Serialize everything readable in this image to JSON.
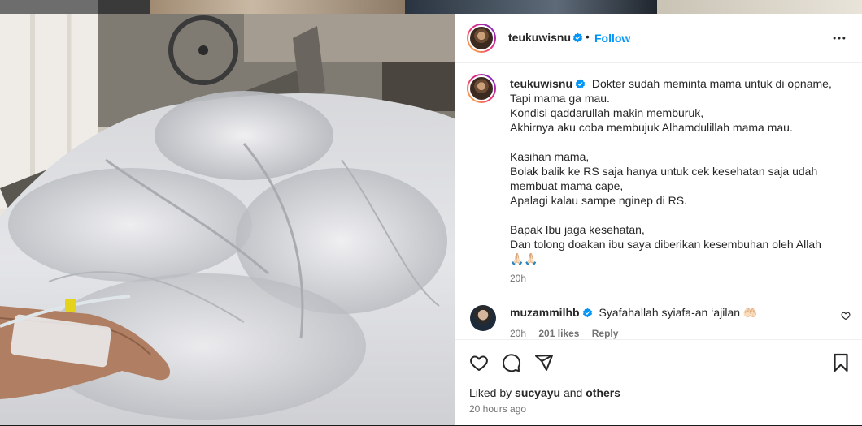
{
  "post": {
    "author": "teukuwisnu",
    "follow_label": "Follow",
    "header_separator": "•",
    "caption_lines": [
      "Dokter sudah meminta mama untuk di opname,",
      "Tapi mama ga mau.",
      "Kondisi qaddarullah makin memburuk,",
      "Akhirnya aku coba membujuk Alhamdulillah mama mau.",
      "",
      "Kasihan mama,",
      "Bolak balik ke RS saja hanya untuk cek kesehatan saja udah",
      "membuat mama cape,",
      "Apalagi kalau sampe nginep di RS.",
      "",
      "Bapak Ibu jaga kesehatan,",
      "Dan tolong doakan ibu saya diberikan kesembuhan oleh Allah",
      "🙏🏻🙏🏻"
    ],
    "caption_time": "20h"
  },
  "comment": {
    "author": "muzammilhb",
    "text": "Syafahallah syiafa-an ‘ajilan 🤲🏻",
    "time": "20h",
    "likes": "201 likes",
    "reply_label": "Reply"
  },
  "footer": {
    "liked_by_prefix": "Liked by",
    "liked_by_user": "sucyayu",
    "liked_by_and": "and",
    "liked_by_others": "others",
    "time_ago": "20 hours ago"
  },
  "icons": {
    "verified": "verified-badge-icon",
    "more": "more-options-icon",
    "like": "heart-icon",
    "comment": "comment-icon",
    "share": "share-icon",
    "save": "bookmark-icon"
  },
  "colors": {
    "accent": "#0095f6",
    "muted": "#737373",
    "text": "#262626"
  }
}
